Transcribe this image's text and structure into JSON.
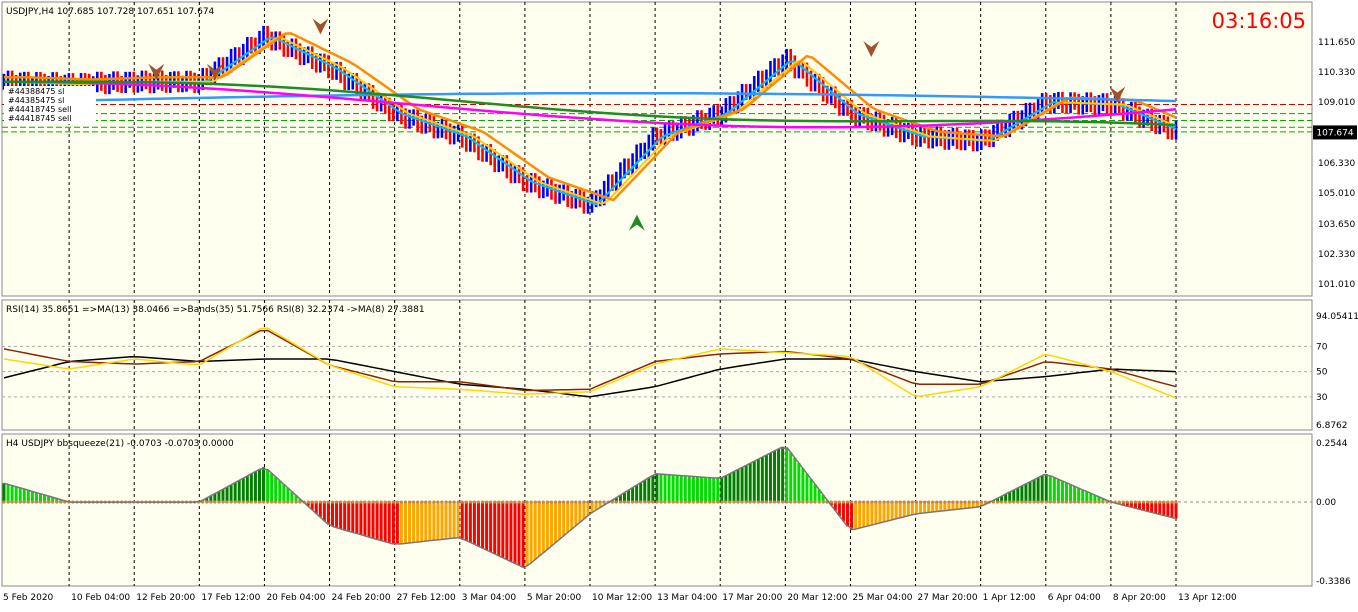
{
  "symbol_header": "USDJPY,H4  107.685 107.728 107.651 107.674",
  "clock": "03:16:05",
  "current_price_label": "107.674",
  "trade_labels": [
    "#44388475 sl",
    "#44385475 sl",
    "#44418745 sell",
    "#44418745 sell"
  ],
  "price_panel": {
    "y_ticks": [
      "111.650",
      "110.330",
      "109.010",
      "107.674",
      "106.330",
      "105.010",
      "103.650",
      "102.330",
      "101.010"
    ]
  },
  "rsi_panel": {
    "label": "RSI(14) 35.8651  =>MA(13) 38.0466  =>Bands(35) 51.7566  RSI(8) 32.2374  ->MA(8) 27.3881",
    "y_ticks": [
      "94.05411",
      "70",
      "50",
      "30",
      "6.8762"
    ]
  },
  "squeeze_panel": {
    "label": "H4 USDJPY bbsqueeze(21) -0.0703 -0.0703 0.0000",
    "y_ticks": [
      "0.2544",
      "0.00",
      "-0.3386"
    ]
  },
  "time_axis": [
    "5 Feb 2020",
    "10 Feb 04:00",
    "12 Feb 20:00",
    "17 Feb 12:00",
    "20 Feb 04:00",
    "24 Feb 20:00",
    "27 Feb 12:00",
    "3 Mar 04:00",
    "5 Mar 20:00",
    "10 Mar 12:00",
    "13 Mar 04:00",
    "17 Mar 20:00",
    "20 Mar 12:00",
    "25 Mar 04:00",
    "27 Mar 20:00",
    "1 Apr 12:00",
    "6 Apr 04:00",
    "8 Apr 20:00",
    "13 Apr 12:00"
  ],
  "colors": {
    "background": "#fffff0",
    "bull_bar": "#0000ff",
    "bear_bar": "#ff0000",
    "ema_fast": "#ffcc00",
    "ema_mid": "#00bfff",
    "ema_slow": "#ff8c00",
    "ma_long": "#228b22",
    "ma_pink": "#ff00ff",
    "ma_blue": "#3399ff",
    "clock": "#ff0000",
    "rsi_fast": "#ffd700",
    "rsi_slow": "#8b2500",
    "rsi_ma": "#000000",
    "sq_up_strong": "#008000",
    "sq_up": "#00dd00",
    "sq_down_strong": "#ff0000",
    "sq_down": "#ffa500"
  },
  "chart_data": {
    "type": "candlestick",
    "title": "USDJPY,H4",
    "x": [
      "5 Feb 2020",
      "10 Feb 04:00",
      "12 Feb 20:00",
      "17 Feb 12:00",
      "20 Feb 04:00",
      "24 Feb 20:00",
      "27 Feb 12:00",
      "3 Mar 04:00",
      "5 Mar 20:00",
      "10 Mar 12:00",
      "13 Mar 04:00",
      "17 Mar 20:00",
      "20 Mar 12:00",
      "25 Mar 04:00",
      "27 Mar 20:00",
      "1 Apr 12:00",
      "6 Apr 04:00",
      "8 Apr 20:00",
      "13 Apr 12:00"
    ],
    "close": [
      109.9,
      109.8,
      109.9,
      109.9,
      111.9,
      110.5,
      108.5,
      107.5,
      105.5,
      104.5,
      107.5,
      108.5,
      110.9,
      108.5,
      107.5,
      107.3,
      109.0,
      108.9,
      107.7
    ],
    "ylim": [
      101.01,
      111.65
    ],
    "hlines": [
      108.9,
      108.5,
      108.2,
      107.9,
      107.7
    ],
    "rsi": {
      "rsi_fast": [
        60,
        52,
        60,
        55,
        86,
        55,
        38,
        36,
        32,
        34,
        56,
        68,
        65,
        62,
        30,
        38,
        64,
        50,
        29
      ],
      "rsi_slow": [
        68,
        58,
        56,
        58,
        84,
        55,
        42,
        42,
        35,
        36,
        58,
        64,
        66,
        60,
        40,
        40,
        58,
        52,
        38
      ],
      "rsi_ma": [
        45,
        58,
        62,
        58,
        60,
        60,
        50,
        40,
        36,
        30,
        38,
        52,
        60,
        60,
        50,
        42,
        46,
        52,
        50
      ],
      "ylim": [
        6.8762,
        94.05411
      ],
      "levels": [
        70,
        50,
        30
      ]
    },
    "bbsqueeze": {
      "values": [
        0.08,
        0.0,
        0.0,
        0.0,
        0.15,
        -0.1,
        -0.18,
        -0.15,
        -0.28,
        -0.05,
        0.12,
        0.1,
        0.24,
        -0.12,
        -0.05,
        -0.02,
        0.12,
        0.0,
        -0.07
      ],
      "ylim": [
        -0.3386,
        0.2544
      ]
    }
  }
}
